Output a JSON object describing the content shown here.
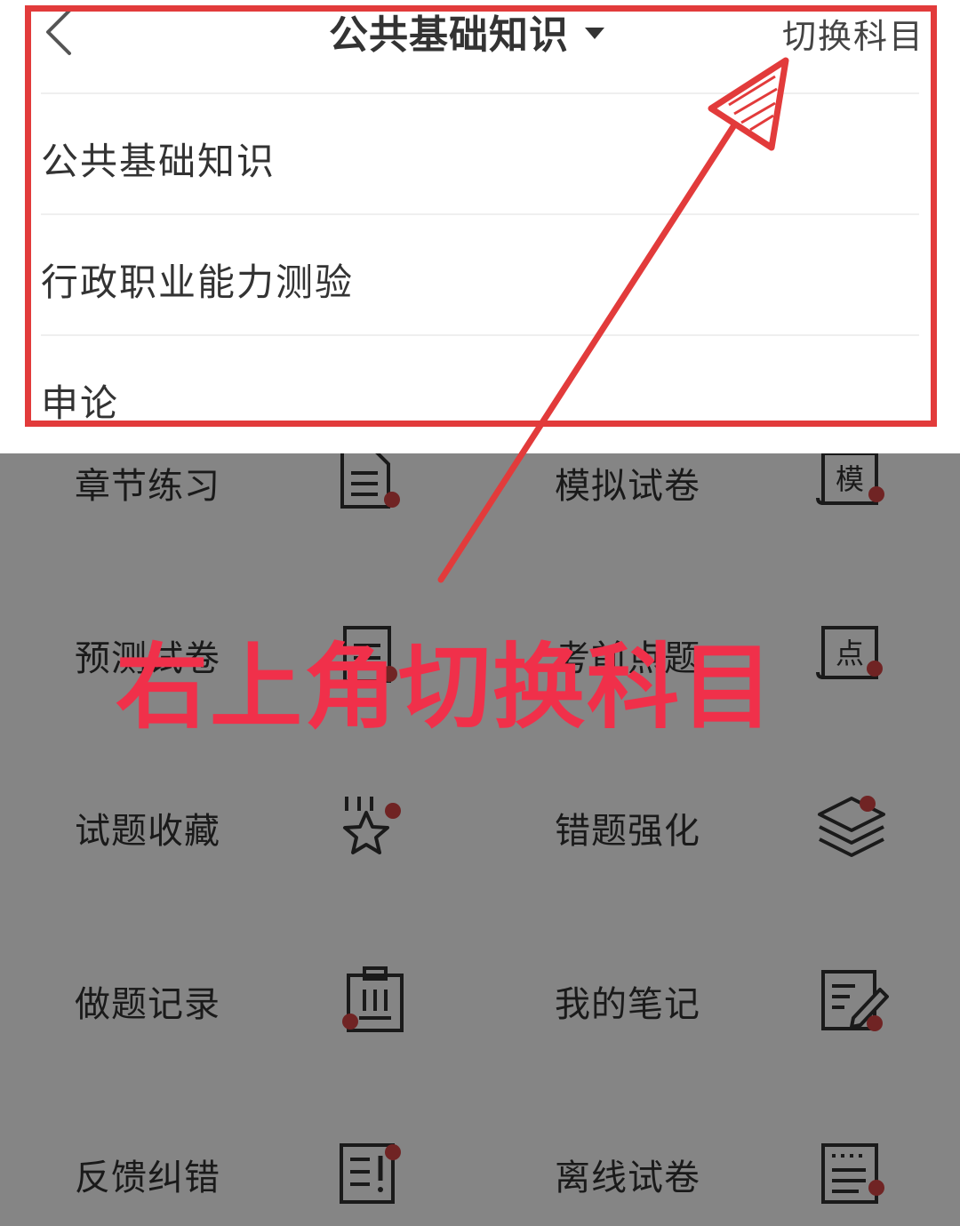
{
  "header": {
    "title": "公共基础知识",
    "switch_label": "切换科目"
  },
  "dropdown": {
    "items": [
      "公共基础知识",
      "行政职业能力测验",
      "申论"
    ]
  },
  "grid": {
    "tiles": [
      {
        "label": "章节练习",
        "icon": "document-icon"
      },
      {
        "label": "模拟试卷",
        "icon": "mock-exam-icon",
        "icon_char": "模"
      },
      {
        "label": "预测试卷",
        "icon": "forecast-icon"
      },
      {
        "label": "考前点题",
        "icon": "key-point-icon",
        "icon_char": "点"
      },
      {
        "label": "试题收藏",
        "icon": "star-icon"
      },
      {
        "label": "错题强化",
        "icon": "layers-icon"
      },
      {
        "label": "做题记录",
        "icon": "clipboard-icon"
      },
      {
        "label": "我的笔记",
        "icon": "note-edit-icon"
      },
      {
        "label": "反馈纠错",
        "icon": "feedback-icon"
      },
      {
        "label": "离线试卷",
        "icon": "offline-paper-icon"
      }
    ]
  },
  "annotation": {
    "text": "右上角切换科目",
    "color": "#f0304a"
  },
  "colors": {
    "accent_red": "#e23b3b",
    "icon_dot": "#d64545"
  }
}
